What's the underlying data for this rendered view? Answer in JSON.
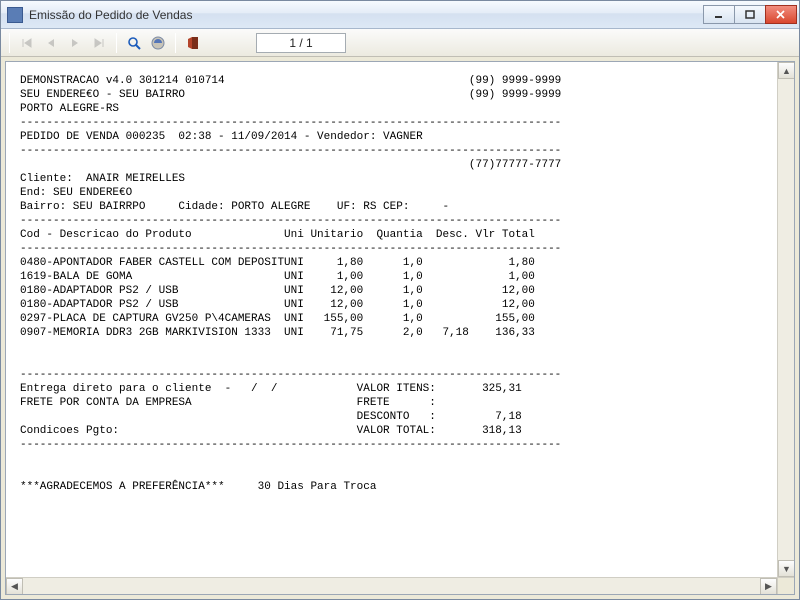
{
  "window": {
    "title": "Emissão do Pedido de Vendas"
  },
  "toolbar": {
    "page_indicator": "1 / 1"
  },
  "header": {
    "line1_left": "DEMONSTRACAO v4.0 301214 010714",
    "line1_right": "(99) 9999-9999",
    "line2_left": "SEU ENDERE€O - SEU BAIRRO",
    "line2_right": "(99) 9999-9999",
    "line3": "PORTO ALEGRE-RS"
  },
  "order": {
    "title": "PEDIDO DE VENDA 000235",
    "time": "02:38",
    "date": "11/09/2014",
    "seller_label": "Vendedor:",
    "seller": "VAGNER"
  },
  "customer": {
    "phone": "(77)77777-7777",
    "name_label": "Cliente:",
    "name": "ANAIR MEIRELLES",
    "addr_label": "End:",
    "addr": "SEU ENDERE€O",
    "bairro_label": "Bairro:",
    "bairro": "SEU BAIRRPO",
    "city_label": "Cidade:",
    "city": "PORTO ALEGRE",
    "uf_label": "UF:",
    "uf": "RS",
    "cep_label": "CEP:",
    "cep": "    -"
  },
  "columns": {
    "cod": "Cod",
    "desc": "Descricao do Produto",
    "uni": "Uni",
    "unit": "Unitario",
    "qty": "Quantia",
    "disc": "Desc.",
    "total": "Vlr Total"
  },
  "items": [
    {
      "cod": "0480",
      "desc": "APONTADOR FABER CASTELL COM DEPOSIT",
      "uni": "UNI",
      "unit": "1,80",
      "qty": "1,0",
      "disc": "",
      "total": "1,80"
    },
    {
      "cod": "1619",
      "desc": "BALA DE GOMA",
      "uni": "UNI",
      "unit": "1,00",
      "qty": "1,0",
      "disc": "",
      "total": "1,00"
    },
    {
      "cod": "0180",
      "desc": "ADAPTADOR PS2 / USB",
      "uni": "UNI",
      "unit": "12,00",
      "qty": "1,0",
      "disc": "",
      "total": "12,00"
    },
    {
      "cod": "0180",
      "desc": "ADAPTADOR PS2 / USB",
      "uni": "UNI",
      "unit": "12,00",
      "qty": "1,0",
      "disc": "",
      "total": "12,00"
    },
    {
      "cod": "0297",
      "desc": "PLACA DE CAPTURA GV250 P\\4CAMERAS",
      "uni": "UNI",
      "unit": "155,00",
      "qty": "1,0",
      "disc": "",
      "total": "155,00"
    },
    {
      "cod": "0907",
      "desc": "MEMORIA DDR3 2GB MARKIVISION 1333",
      "uni": "UNI",
      "unit": "71,75",
      "qty": "2,0",
      "disc": "7,18",
      "total": "136,33"
    }
  ],
  "footer": {
    "delivery": "Entrega direto para o cliente  -   /  /",
    "freight": "FRETE POR CONTA DA EMPRESA",
    "payment_label": "Condicoes Pgto:",
    "items_label": "VALOR ITENS:",
    "items_value": "325,31",
    "freight_label": "FRETE      :",
    "freight_value": "",
    "discount_label": "DESCONTO   :",
    "discount_value": "7,18",
    "total_label": "VALOR TOTAL:",
    "total_value": "318,13"
  },
  "thanks": {
    "msg": "***AGRADECEMOS A PREFERÊNCIA***",
    "exchange": "30 Dias Para Troca"
  },
  "chart_data": {
    "type": "table",
    "title": "PEDIDO DE VENDA 000235",
    "columns": [
      "Cod",
      "Descricao do Produto",
      "Uni",
      "Unitario",
      "Quantia",
      "Desc.",
      "Vlr Total"
    ],
    "rows": [
      [
        "0480",
        "APONTADOR FABER CASTELL COM DEPOSIT",
        "UNI",
        1.8,
        1.0,
        null,
        1.8
      ],
      [
        "1619",
        "BALA DE GOMA",
        "UNI",
        1.0,
        1.0,
        null,
        1.0
      ],
      [
        "0180",
        "ADAPTADOR PS2 / USB",
        "UNI",
        12.0,
        1.0,
        null,
        12.0
      ],
      [
        "0180",
        "ADAPTADOR PS2 / USB",
        "UNI",
        12.0,
        1.0,
        null,
        12.0
      ],
      [
        "0297",
        "PLACA DE CAPTURA GV250 P\\4CAMERAS",
        "UNI",
        155.0,
        1.0,
        null,
        155.0
      ],
      [
        "0907",
        "MEMORIA DDR3 2GB MARKIVISION 1333",
        "UNI",
        71.75,
        2.0,
        7.18,
        136.33
      ]
    ],
    "totals": {
      "items": 325.31,
      "discount": 7.18,
      "total": 318.13
    }
  }
}
